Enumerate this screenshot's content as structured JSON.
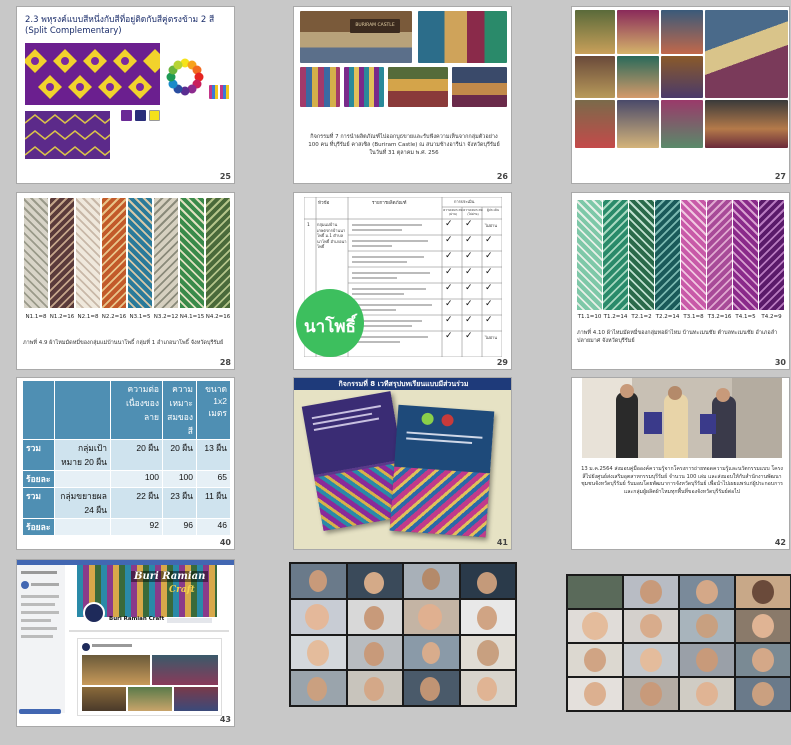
{
  "slides": [
    {
      "number": "25",
      "title": "2.3 พหุรงค์แบบสีหนึ่งกับสีที่อยู่ติดกับสีคู่ตรงข้าม 2 สี",
      "subtitle": "(Split Complementary)"
    },
    {
      "number": "26",
      "sign_text": "BURIRAM CASTLE",
      "caption": "กิจกรรมที่ 7 การนำผลิตภัณฑ์ไปออกบูธขายและรับฟังความเห็นจากกลุ่มตัวอย่าง 100 คน ที่บุรีรัมย์ คาสเซิล (Buriram Castle) ณ สนามช้างอารีน่า จังหวัดบุรีรัมย์ ในวันที่ 31 ตุลาคม พ.ศ. 256"
    },
    {
      "number": "27"
    },
    {
      "number": "28",
      "labels": [
        "N1.1=8",
        "N1.2=16",
        "N2.1=8",
        "N2.2=16",
        "N3.1=5",
        "N3.2=12",
        "N4.1=15",
        "N4.2=16"
      ],
      "caption": "ภาพที่ 4.9 ผ้าไหมมัดหมี่ของกลุ่มแม่บ้านนาโพธิ์ กลุ่มที่ 1 อำเภอนาโพธิ์ จังหวัดบุรีรัมย์"
    },
    {
      "number": "29",
      "badge": "นาโพธิ์",
      "header_topic": "หัวข้อ",
      "header_detail": "รายการผลิตภัณฑ์",
      "header_eval": "การประเมิน",
      "header_sub1": "ความเหมาะสม (ผ่าน)",
      "header_sub2": "ความเหมาะสม (ไม่ผ่าน)",
      "header_sub3": "ผู้ประเมิน",
      "row_no": "1",
      "row_topic": "กลุ่มแม่บ้านเกษตรกรบ้านนาโพธิ์ ม.1 ตำบลนาโพธิ์ อำเภอนาโพธิ์",
      "cell_note": "ไม่ผ่าน",
      "check": "✓"
    },
    {
      "number": "30",
      "labels": [
        "T1.1=10",
        "T1.2=14",
        "T2.1=2",
        "T2.2=14",
        "T3.1=8",
        "T3.2=16",
        "T4.1=5",
        "T4.2=9"
      ],
      "caption": "ภาพที่ 4.10 ผ้าไหมมัดหมี่ของกลุ่มทอผ้าไหม บ้านทะเมนชัย ตำบลทะเมนชัย อำเภอลำปลายมาศ จังหวัดบุรีรัมย์"
    },
    {
      "number": "40",
      "col1": "ความต่อเนื่องของลาย",
      "col2": "ความเหมาะสมของสี",
      "col3": "ขนาด 1x2 เมตร",
      "rows": [
        {
          "side": "รวม",
          "group": "กลุ่มเป้าหมาย 20 ผืน",
          "v1": "20 ผืน",
          "v2": "20 ผืน",
          "v3": "13 ผืน"
        },
        {
          "side": "ร้อยละ",
          "group": "",
          "v1": "100",
          "v2": "100",
          "v3": "65"
        },
        {
          "side": "รวม",
          "group": "กลุ่มขยายผล 24 ผืน",
          "v1": "22 ผืน",
          "v2": "23 ผืน",
          "v3": "11 ผืน"
        },
        {
          "side": "ร้อยละ",
          "group": "",
          "v1": "92",
          "v2": "96",
          "v3": "46"
        }
      ]
    },
    {
      "number": "41",
      "title": "กิจกรรมที่ 8 เวทีสรุปบทเรียนแบบมีส่วนร่วม"
    },
    {
      "number": "42",
      "caption": "13 ม.ค.2564 ส่งมอบคู่มือองค์ความรู้จากโครงการถ่ายทอดความรู้และนวัตกรรมแบบ โครงสีไปยังศูนย์ส่งเสริมอุตสาหกรรมบุรีรัมย์ จำนวน 100 เล่ม และส่งมอบให้กับสำนักงานพัฒนาชุมชนจังหวัดบุรีรัมย์ รับมอบโดยพัฒนาการจังหวัดบุรีรัมย์ เพื่อนำไปเผยแพร่แก่ผู้ประกอบการและกลุ่มผู้ผลิตผ้าไหมทุกพื้นที่ของจังหวัดบุรีรัมย์ต่อไป"
    },
    {
      "number": "43",
      "brand": "Buri Ramian",
      "brand2": "Craft",
      "page_name": "Buri Ramian Craft"
    },
    {
      "number": ""
    },
    {
      "number": ""
    }
  ]
}
